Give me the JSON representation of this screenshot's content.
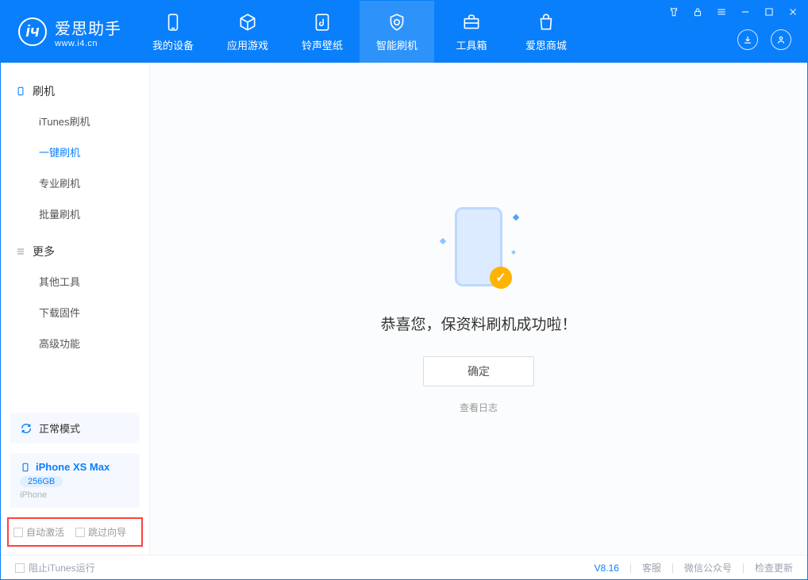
{
  "logo": {
    "main": "爱思助手",
    "sub": "www.i4.cn"
  },
  "nav": {
    "device": "我的设备",
    "apps": "应用游戏",
    "ring": "铃声壁纸",
    "flash": "智能刷机",
    "tools": "工具箱",
    "store": "爱思商城"
  },
  "sidebar": {
    "group_flash": "刷机",
    "items_flash": {
      "itunes": "iTunes刷机",
      "oneclick": "一键刷机",
      "pro": "专业刷机",
      "batch": "批量刷机"
    },
    "group_more": "更多",
    "items_more": {
      "other": "其他工具",
      "firmware": "下载固件",
      "adv": "高级功能"
    },
    "status_mode": "正常模式",
    "device": {
      "name": "iPhone XS Max",
      "capacity": "256GB",
      "type": "iPhone"
    },
    "checkboxes": {
      "auto_activate": "自动激活",
      "skip_guide": "跳过向导"
    }
  },
  "main": {
    "success_text": "恭喜您，保资料刷机成功啦！",
    "ok_button": "确定",
    "view_log": "查看日志"
  },
  "footer": {
    "block_itunes": "阻止iTunes运行",
    "version": "V8.16",
    "service": "客服",
    "wechat": "微信公众号",
    "update": "检查更新"
  }
}
